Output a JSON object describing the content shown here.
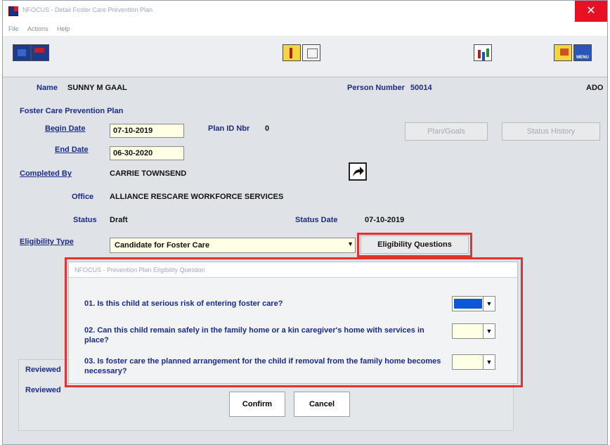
{
  "window": {
    "title": "NFOCUS - Detail Foster Care Prevention Plan",
    "close_symbol": "✕"
  },
  "menu": {
    "file": "File",
    "actions": "Actions",
    "help": "Help"
  },
  "toolbar": {
    "menu_label": "MENU"
  },
  "header": {
    "name_label": "Name",
    "name_value": "SUNNY M GAAL",
    "person_number_label": "Person Number",
    "person_number_value": "50014",
    "code": "ADO"
  },
  "form": {
    "section_title": "Foster Care Prevention Plan",
    "begin_date_label": "Begin Date",
    "begin_date_value": "07-10-2019",
    "plan_id_label": "Plan ID Nbr",
    "plan_id_value": "0",
    "end_date_label": "End Date",
    "end_date_value": "06-30-2020",
    "completed_by_label": "Completed By",
    "completed_by_value": "CARRIE TOWNSEND",
    "office_label": "Office",
    "office_value": "ALLIANCE RESCARE WORKFORCE SERVICES",
    "status_label": "Status",
    "status_value": "Draft",
    "status_date_label": "Status Date",
    "status_date_value": "07-10-2019",
    "eligibility_type_label": "Eligibility Type",
    "eligibility_type_value": "Candidate for Foster Care",
    "reviewed_label_1": "Reviewed",
    "reviewed_label_2": "Reviewed"
  },
  "buttons": {
    "plan_goals": "Plan/Goals",
    "status_history": "Status History",
    "eligibility_questions": "Eligibility Questions",
    "confirm": "Confirm",
    "cancel": "Cancel"
  },
  "dialog": {
    "title": "NFOCUS - Prevention Plan Eligibility Question",
    "q1": "01. Is this child at serious risk of entering foster care?",
    "q2": "02. Can this child remain safely in the family home or a kin caregiver's home with services in place?",
    "q3": "03. Is foster care the planned arrangement for the child if removal from the family home becomes necessary?"
  },
  "colors": {
    "accent_red": "#e23232",
    "selected_blue": "#0a58d8",
    "label_blue": "#1a2a8a"
  }
}
